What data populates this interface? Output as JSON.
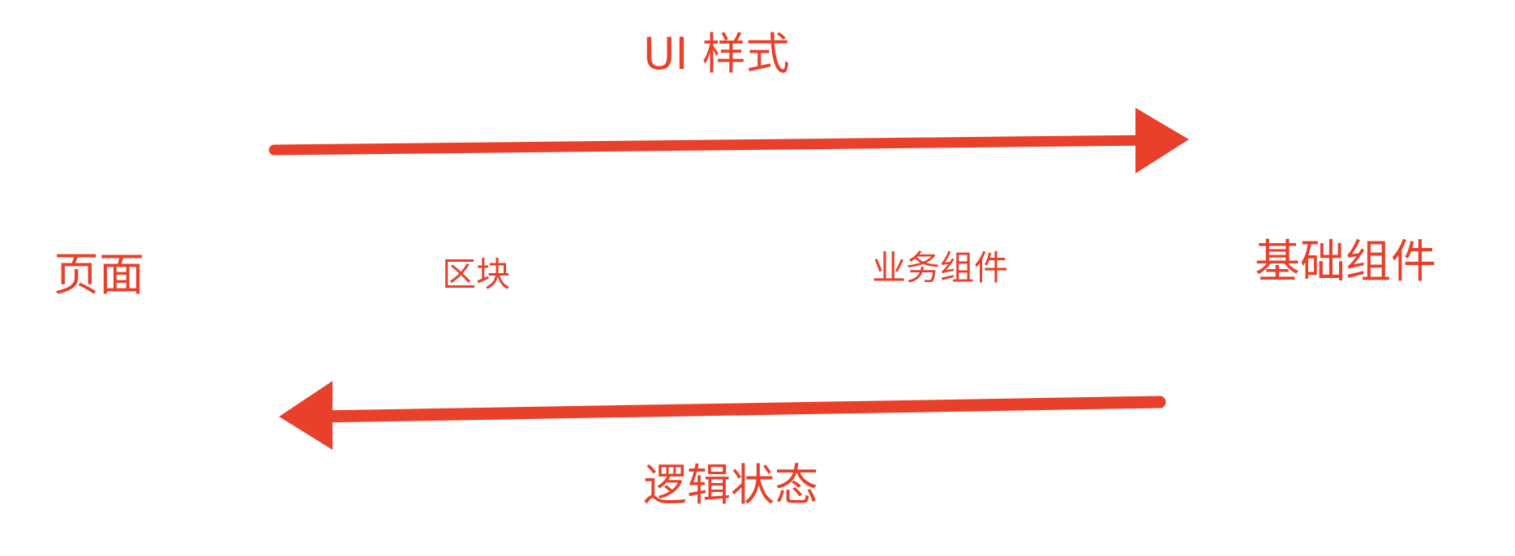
{
  "colors": {
    "accent": "#e8402a"
  },
  "labels": {
    "ui_style": "UI 样式",
    "logic_state": "逻辑状态",
    "page": "页面",
    "block": "区块",
    "business_component": "业务组件",
    "base_component": "基础组件"
  }
}
